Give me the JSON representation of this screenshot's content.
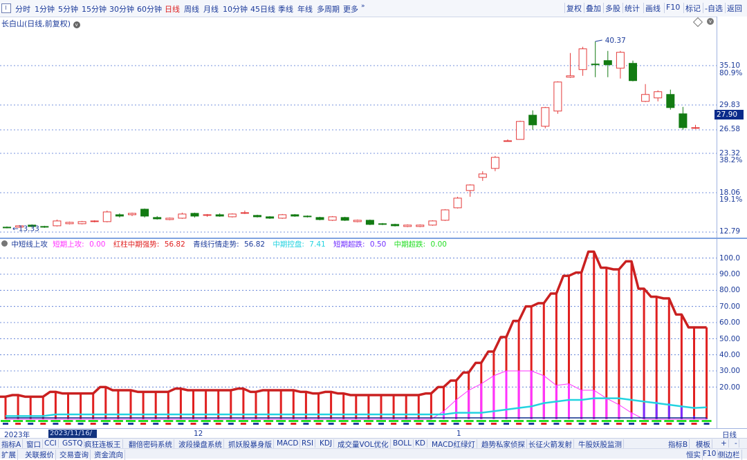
{
  "toolbar": {
    "timeframes": [
      "分时",
      "1分钟",
      "5分钟",
      "15分钟",
      "30分钟",
      "60分钟",
      "日线",
      "周线",
      "月线",
      "10分钟",
      "45日线",
      "季线",
      "年线",
      "多周期",
      "更多"
    ],
    "active_timeframe": "日线",
    "buttons": [
      "复权",
      "叠加",
      "多股",
      "统计",
      "画线",
      "F10",
      "标记",
      "-自选",
      "返回"
    ]
  },
  "price_panel": {
    "title": "长白山(日线,前复权)",
    "y_labels": [
      "35.10",
      "80.9%",
      "29.83",
      "26.58",
      "23.32",
      "38.2%",
      "18.06",
      "19.1%",
      "12.79"
    ],
    "current_price": "27.90",
    "high_label": "40.37",
    "low_label": "13.33",
    "colors": {
      "up": "#e43a3a",
      "down": "#127b12",
      "grid": "#4a6fd1",
      "tag": "#0a2a8a"
    }
  },
  "indicator_panel": {
    "header": [
      {
        "label": "中短线上攻",
        "value": "",
        "color": "#1b3a9a"
      },
      {
        "label": "短期上攻:",
        "value": "0.00",
        "color": "#ff33ff"
      },
      {
        "label": "红柱中期强势:",
        "value": "56.82",
        "color": "#e02020"
      },
      {
        "label": "青线行情走势:",
        "value": "56.82",
        "color": "#1b3a9a"
      },
      {
        "label": "中期控盘:",
        "value": "7.41",
        "color": "#22d3e0"
      },
      {
        "label": "短期超跌:",
        "value": "0.50",
        "color": "#6f2cff"
      },
      {
        "label": "中期超跌:",
        "value": "0.00",
        "color": "#22dd22"
      }
    ],
    "y_labels": [
      "100.0",
      "90.00",
      "80.00",
      "70.00",
      "60.00",
      "50.00",
      "40.00",
      "30.00",
      "20.00"
    ]
  },
  "date_axis": {
    "labels": [
      "2023年",
      "12",
      "1",
      "日线"
    ],
    "selected": "2023/11/16/四"
  },
  "bottom_tabs_row1": [
    "指标A",
    "窗口",
    "CCI",
    "GSTQ",
    "疯狂连板王",
    "翻倍密码系统",
    "波段操盘系统",
    "抓妖股暴身版",
    "MACD",
    "RSI",
    "KDJ",
    "成交量VOL优化",
    "BOLL",
    "KD",
    "MACD红绿灯",
    "趋势私家侦探",
    "长征火箭发射",
    "牛股妖股监测",
    "指标B",
    "模板",
    "+",
    "-"
  ],
  "bottom_tabs_row2": [
    "扩展",
    "关联报价",
    "交易查询",
    "资金流向",
    "恒实",
    "F10",
    "侧边栏"
  ],
  "chart_data": [
    {
      "type": "candlestick",
      "title": "长白山(日线,前复权)",
      "ylim": [
        12.79,
        40.37
      ],
      "candles": [
        {
          "o": 13.5,
          "c": 13.4,
          "h": 13.6,
          "l": 13.33
        },
        {
          "o": 13.5,
          "c": 13.7,
          "h": 13.8,
          "l": 13.4
        },
        {
          "o": 13.8,
          "c": 13.6,
          "h": 13.9,
          "l": 13.5
        },
        {
          "o": 13.6,
          "c": 13.5,
          "h": 13.7,
          "l": 13.4
        },
        {
          "o": 13.7,
          "c": 14.4,
          "h": 14.6,
          "l": 13.6
        },
        {
          "o": 14.0,
          "c": 14.2,
          "h": 14.3,
          "l": 13.9
        },
        {
          "o": 14.0,
          "c": 14.3,
          "h": 14.4,
          "l": 13.9
        },
        {
          "o": 14.3,
          "c": 14.4,
          "h": 14.5,
          "l": 14.2
        },
        {
          "o": 14.3,
          "c": 15.7,
          "h": 15.9,
          "l": 14.2
        },
        {
          "o": 15.3,
          "c": 15.1,
          "h": 15.5,
          "l": 14.9
        },
        {
          "o": 15.3,
          "c": 15.5,
          "h": 15.6,
          "l": 15.1
        },
        {
          "o": 16.1,
          "c": 15.1,
          "h": 16.2,
          "l": 14.9
        },
        {
          "o": 14.9,
          "c": 14.7,
          "h": 15.1,
          "l": 14.6
        },
        {
          "o": 14.6,
          "c": 14.8,
          "h": 14.9,
          "l": 14.5
        },
        {
          "o": 14.8,
          "c": 15.4,
          "h": 15.6,
          "l": 14.7
        },
        {
          "o": 15.5,
          "c": 15.1,
          "h": 15.6,
          "l": 14.9
        },
        {
          "o": 15.2,
          "c": 15.3,
          "h": 15.4,
          "l": 15.0
        },
        {
          "o": 15.3,
          "c": 15.1,
          "h": 15.5,
          "l": 15.0
        },
        {
          "o": 15.0,
          "c": 15.4,
          "h": 15.5,
          "l": 14.9
        },
        {
          "o": 15.5,
          "c": 15.6,
          "h": 15.9,
          "l": 15.4
        },
        {
          "o": 15.2,
          "c": 15.0,
          "h": 15.3,
          "l": 14.9
        },
        {
          "o": 15.0,
          "c": 14.8,
          "h": 15.1,
          "l": 14.7
        },
        {
          "o": 14.8,
          "c": 15.3,
          "h": 15.4,
          "l": 14.7
        },
        {
          "o": 15.3,
          "c": 15.1,
          "h": 15.4,
          "l": 15.0
        },
        {
          "o": 15.1,
          "c": 15.0,
          "h": 15.2,
          "l": 14.9
        },
        {
          "o": 14.9,
          "c": 14.6,
          "h": 15.0,
          "l": 14.5
        },
        {
          "o": 14.5,
          "c": 15.0,
          "h": 15.1,
          "l": 14.4
        },
        {
          "o": 14.9,
          "c": 14.5,
          "h": 15.0,
          "l": 14.4
        },
        {
          "o": 14.3,
          "c": 14.5,
          "h": 14.6,
          "l": 14.2
        },
        {
          "o": 14.5,
          "c": 13.9,
          "h": 14.6,
          "l": 13.8
        },
        {
          "o": 14.0,
          "c": 13.9,
          "h": 14.1,
          "l": 13.8
        },
        {
          "o": 13.9,
          "c": 13.7,
          "h": 14.0,
          "l": 13.6
        },
        {
          "o": 13.6,
          "c": 13.8,
          "h": 13.9,
          "l": 13.5
        },
        {
          "o": 13.6,
          "c": 13.8,
          "h": 13.9,
          "l": 13.5
        },
        {
          "o": 13.8,
          "c": 14.4,
          "h": 14.5,
          "l": 13.7
        },
        {
          "o": 14.5,
          "c": 16.0,
          "h": 16.1,
          "l": 14.4
        },
        {
          "o": 16.3,
          "c": 17.7,
          "h": 17.9,
          "l": 16.2
        },
        {
          "o": 18.8,
          "c": 19.6,
          "h": 19.7,
          "l": 17.9
        },
        {
          "o": 20.7,
          "c": 21.2,
          "h": 21.6,
          "l": 20.2
        },
        {
          "o": 22.0,
          "c": 23.6,
          "h": 23.8,
          "l": 21.6
        },
        {
          "o": 26.0,
          "c": 26.0,
          "h": 26.2,
          "l": 26.0
        },
        {
          "o": 26.2,
          "c": 28.8,
          "h": 28.9,
          "l": 26.2
        },
        {
          "o": 29.7,
          "c": 28.3,
          "h": 30.4,
          "l": 27.6
        },
        {
          "o": 28.1,
          "c": 30.8,
          "h": 30.9,
          "l": 27.8
        },
        {
          "o": 30.3,
          "c": 34.5,
          "h": 34.6,
          "l": 29.9
        },
        {
          "o": 35.2,
          "c": 35.4,
          "h": 38.7,
          "l": 35.1
        },
        {
          "o": 36.3,
          "c": 39.3,
          "h": 39.6,
          "l": 35.4
        },
        {
          "o": 37.1,
          "c": 37.0,
          "h": 40.37,
          "l": 35.2
        },
        {
          "o": 37.6,
          "c": 37.0,
          "h": 39.0,
          "l": 35.2
        },
        {
          "o": 36.5,
          "c": 38.8,
          "h": 39.0,
          "l": 35.0
        },
        {
          "o": 37.2,
          "c": 34.7,
          "h": 37.6,
          "l": 34.6
        },
        {
          "o": 31.7,
          "c": 32.7,
          "h": 34.2,
          "l": 31.6
        },
        {
          "o": 32.2,
          "c": 33.1,
          "h": 33.3,
          "l": 31.7
        },
        {
          "o": 32.7,
          "c": 30.8,
          "h": 33.4,
          "l": 30.5
        },
        {
          "o": 29.9,
          "c": 27.9,
          "h": 30.9,
          "l": 27.6
        },
        {
          "o": 27.9,
          "c": 27.9,
          "h": 28.3,
          "l": 27.7
        }
      ]
    },
    {
      "type": "bar",
      "title": "中短线上攻",
      "ylim": [
        0,
        105
      ],
      "series": [
        {
          "name": "红柱中期强势",
          "values": [
            14,
            15,
            14,
            14,
            17,
            16,
            16,
            16,
            20,
            18,
            18,
            17,
            17,
            17,
            19,
            18,
            18,
            18,
            18,
            19,
            17,
            18,
            18,
            18,
            17,
            16,
            17,
            16,
            15,
            15,
            15,
            15,
            15,
            15,
            16,
            20,
            24,
            29,
            35,
            42,
            51,
            61,
            70,
            72,
            78,
            89,
            91,
            104,
            94,
            93,
            98,
            81,
            76,
            75,
            65,
            57,
            57
          ]
        },
        {
          "name": "短期上攻",
          "values": [
            0,
            0,
            0,
            0,
            0,
            0,
            0,
            0,
            0,
            0,
            0,
            0,
            0,
            0,
            0,
            0,
            0,
            0,
            0,
            0,
            0,
            0,
            0,
            0,
            0,
            0,
            0,
            0,
            0,
            0,
            0,
            0,
            0,
            0,
            0,
            5,
            12,
            18,
            22,
            27,
            30,
            30,
            30,
            27,
            21,
            22,
            18,
            18,
            13,
            9,
            4,
            0,
            0,
            0,
            0,
            0,
            0
          ]
        },
        {
          "name": "中期控盘",
          "values": [
            2,
            2,
            2,
            2,
            3,
            3,
            3,
            3,
            3,
            3,
            3,
            3,
            3,
            3,
            3,
            3,
            3,
            3,
            3,
            3,
            3,
            3,
            3,
            3,
            3,
            3,
            3,
            3,
            3,
            3,
            3,
            3,
            3,
            3,
            3,
            3,
            4,
            4,
            4,
            5,
            6,
            7,
            8,
            10,
            11,
            12,
            12,
            13,
            13,
            13,
            12,
            11,
            10,
            9,
            8,
            7,
            7.41
          ]
        },
        {
          "name": "短期超跌",
          "values": [
            0,
            0,
            0,
            0,
            0,
            0,
            0,
            0,
            0,
            0,
            0,
            0,
            0,
            0,
            0,
            0,
            0,
            0,
            0,
            0,
            0,
            0,
            0,
            0,
            0,
            0,
            0,
            0,
            0,
            0,
            0,
            0,
            0,
            0,
            0,
            0,
            0,
            0,
            0,
            0,
            0,
            0,
            0,
            0,
            0,
            0,
            0,
            0,
            0,
            0,
            0,
            10,
            11,
            10,
            8,
            2,
            0.5
          ]
        },
        {
          "name": "中期超跌",
          "values": [
            0,
            0,
            0,
            0,
            0,
            0,
            0,
            0,
            0,
            0,
            0,
            0,
            0,
            0,
            0,
            0,
            0,
            0,
            0,
            0,
            0,
            0,
            0,
            0,
            0,
            0,
            0,
            0,
            0,
            0,
            0,
            0,
            0,
            0,
            0,
            0,
            0,
            0,
            0,
            0,
            0,
            0,
            0,
            0,
            0,
            0,
            0,
            0,
            0,
            0,
            0,
            0,
            0,
            0,
            0,
            0,
            0
          ]
        }
      ]
    }
  ]
}
